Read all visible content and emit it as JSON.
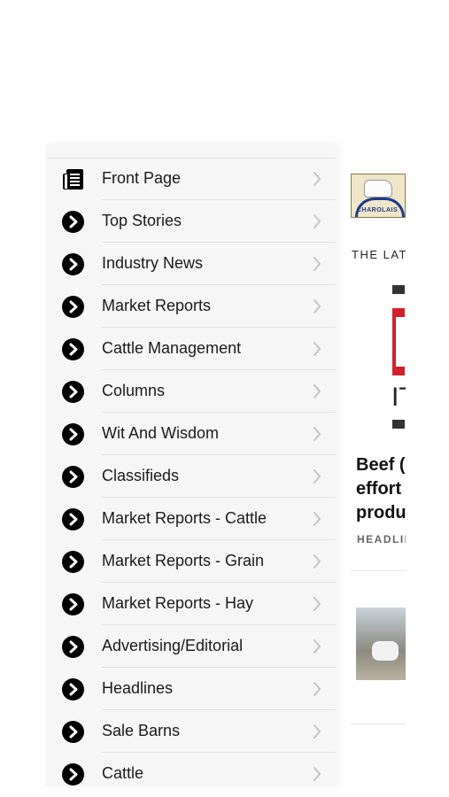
{
  "background_article": {
    "banner_text": "CHAROLAIS",
    "section_label": "THE LAT",
    "logo_text": "IT",
    "headline_lines": [
      "Beef (",
      "effort",
      "produ"
    ],
    "tag_text": "HEADLII"
  },
  "menu": {
    "items": [
      {
        "label": "Front Page",
        "icon": "newspaper-icon"
      },
      {
        "label": "Top Stories",
        "icon": "arrow-circle-icon"
      },
      {
        "label": "Industry News",
        "icon": "arrow-circle-icon"
      },
      {
        "label": "Market Reports",
        "icon": "arrow-circle-icon"
      },
      {
        "label": "Cattle Management",
        "icon": "arrow-circle-icon"
      },
      {
        "label": "Columns",
        "icon": "arrow-circle-icon"
      },
      {
        "label": "Wit And Wisdom",
        "icon": "arrow-circle-icon"
      },
      {
        "label": "Classifieds",
        "icon": "arrow-circle-icon"
      },
      {
        "label": "Market Reports - Cattle",
        "icon": "arrow-circle-icon"
      },
      {
        "label": "Market Reports - Grain",
        "icon": "arrow-circle-icon"
      },
      {
        "label": "Market Reports - Hay",
        "icon": "arrow-circle-icon"
      },
      {
        "label": "Advertising/Editorial",
        "icon": "arrow-circle-icon"
      },
      {
        "label": "Headlines",
        "icon": "arrow-circle-icon"
      },
      {
        "label": "Sale Barns",
        "icon": "arrow-circle-icon"
      },
      {
        "label": "Cattle",
        "icon": "arrow-circle-icon"
      }
    ]
  },
  "colors": {
    "drawer_bg": "#f6f6f6",
    "text": "#1a1a1a",
    "icon": "#000000",
    "chevron": "#c4c4c4",
    "logo_red": "#d21f2b"
  }
}
